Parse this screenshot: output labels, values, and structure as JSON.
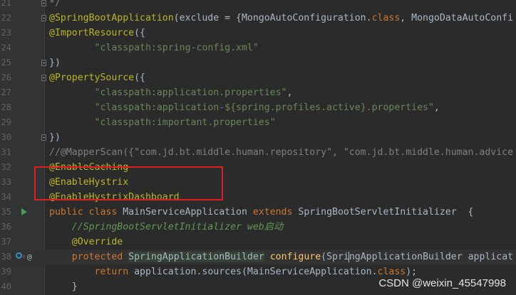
{
  "editor": {
    "lines": [
      {
        "num": "21",
        "segs": [
          {
            "t": "c",
            "v": "*/"
          }
        ]
      },
      {
        "num": "22",
        "segs": [
          {
            "t": "a",
            "v": "@SpringBootApplication"
          },
          {
            "t": "p",
            "v": "(exclude = {MongoAutoConfiguration."
          },
          {
            "t": "k",
            "v": "class"
          },
          {
            "t": "p",
            "v": ", MongoDataAutoConfi"
          }
        ]
      },
      {
        "num": "23",
        "segs": [
          {
            "t": "a",
            "v": "@ImportResource"
          },
          {
            "t": "p",
            "v": "({"
          }
        ]
      },
      {
        "num": "24",
        "segs": [
          {
            "t": "p",
            "v": "        "
          },
          {
            "t": "s",
            "v": "\"classpath:spring-config.xml\""
          }
        ]
      },
      {
        "num": "25",
        "segs": [
          {
            "t": "p",
            "v": "})"
          }
        ]
      },
      {
        "num": "26",
        "segs": [
          {
            "t": "a",
            "v": "@PropertySource"
          },
          {
            "t": "p",
            "v": "({"
          }
        ]
      },
      {
        "num": "27",
        "segs": [
          {
            "t": "p",
            "v": "        "
          },
          {
            "t": "s",
            "v": "\"classpath:application.properties\""
          },
          {
            "t": "p",
            "v": ","
          }
        ]
      },
      {
        "num": "28",
        "segs": [
          {
            "t": "p",
            "v": "        "
          },
          {
            "t": "s",
            "v": "\"classpath:application-${spring.profiles.active}.properties\""
          },
          {
            "t": "p",
            "v": ","
          }
        ]
      },
      {
        "num": "29",
        "segs": [
          {
            "t": "p",
            "v": "        "
          },
          {
            "t": "s",
            "v": "\"classpath:important.properties\""
          }
        ]
      },
      {
        "num": "30",
        "segs": [
          {
            "t": "p",
            "v": "})"
          }
        ]
      },
      {
        "num": "31",
        "segs": [
          {
            "t": "c",
            "v": "//@MapperScan({\"com.jd.bt.middle.human.repository\", \"com.jd.bt.middle.human.advice"
          }
        ]
      },
      {
        "num": "32",
        "segs": [
          {
            "t": "a",
            "v": "@EnableCaching"
          }
        ]
      },
      {
        "num": "33",
        "segs": [
          {
            "t": "a",
            "v": "@EnableHystrix"
          }
        ]
      },
      {
        "num": "34",
        "segs": [
          {
            "t": "a",
            "v": "@EnableHystrixDashboard"
          }
        ]
      },
      {
        "num": "35",
        "segs": [
          {
            "t": "k",
            "v": "public class "
          },
          {
            "t": "p",
            "v": "MainServiceApplication "
          },
          {
            "t": "k",
            "v": "extends "
          },
          {
            "t": "p",
            "v": "SpringBootServletInitializer  {"
          }
        ]
      },
      {
        "num": "36",
        "segs": [
          {
            "t": "p",
            "v": "    "
          },
          {
            "t": "j",
            "v": "//SpringBootServletInitializer web启动"
          }
        ]
      },
      {
        "num": "37",
        "segs": [
          {
            "t": "p",
            "v": "    "
          },
          {
            "t": "a",
            "v": "@Override"
          }
        ]
      },
      {
        "num": "38",
        "segs": [
          {
            "t": "p",
            "v": "    "
          },
          {
            "t": "k",
            "v": "protected "
          },
          {
            "t": "h",
            "v": "SpringApplicationBuilder"
          },
          {
            "t": "p",
            "v": " "
          },
          {
            "t": "f",
            "v": "configure"
          },
          {
            "t": "p",
            "v": "(Spri"
          },
          {
            "t": "caret",
            "v": ""
          },
          {
            "t": "p",
            "v": "ngApplicationBuilder applicat"
          }
        ]
      },
      {
        "num": "39",
        "segs": [
          {
            "t": "p",
            "v": "        "
          },
          {
            "t": "k",
            "v": "return "
          },
          {
            "t": "p",
            "v": "application.sources(MainServiceApplication."
          },
          {
            "t": "k",
            "v": "class"
          },
          {
            "t": "p",
            "v": ");"
          }
        ]
      },
      {
        "num": "40",
        "segs": [
          {
            "t": "p",
            "v": "    }"
          }
        ]
      }
    ],
    "fold_lines": [
      21,
      22,
      25,
      26,
      30
    ],
    "run_line": 35,
    "override_line": 38,
    "current_line": 38,
    "boxed_lines": [
      33,
      34
    ]
  },
  "watermark": "CSDN @weixin_45547998",
  "colors": {
    "annotation": "#bbb529",
    "keyword": "#cc7832",
    "string": "#6a8759",
    "comment": "#808080",
    "highlight_box": "#e02020"
  }
}
